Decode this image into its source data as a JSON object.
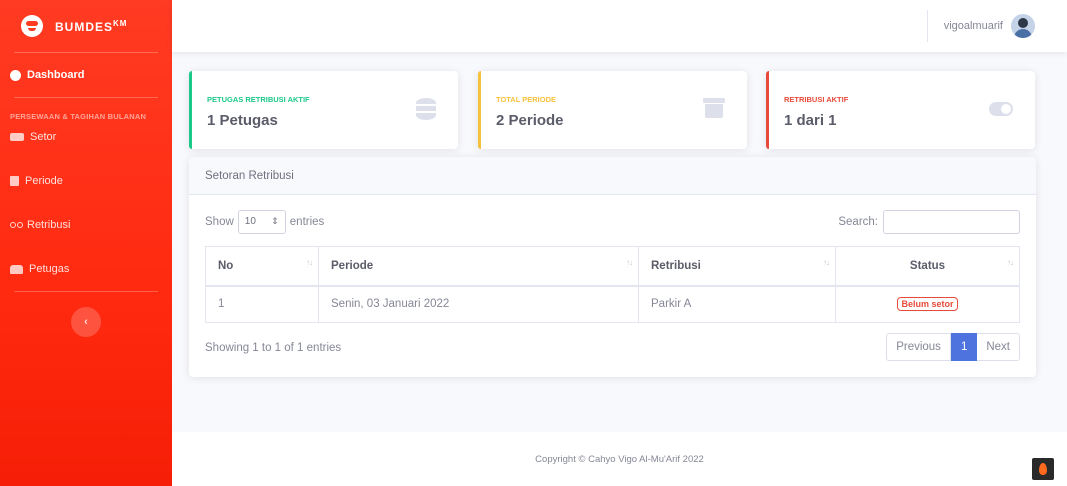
{
  "brand": {
    "name": "BUMDES",
    "superscript": "KM"
  },
  "sidebar": {
    "dashboard": "Dashboard",
    "heading": "PERSEWAAN & TAGIHAN BULANAN",
    "items": [
      {
        "label": "Setor",
        "icon": "money-icon"
      },
      {
        "label": "Periode",
        "icon": "calendar-icon"
      },
      {
        "label": "Retribusi",
        "icon": "bicycle-icon"
      },
      {
        "label": "Petugas",
        "icon": "users-icon"
      }
    ],
    "toggle": "‹"
  },
  "topbar": {
    "username": "vigoalmuarif"
  },
  "cards": [
    {
      "label": "Petugas Retribusi Aktif",
      "value": "1 Petugas",
      "color": "#1cc88a",
      "icon": "database-icon"
    },
    {
      "label": "Total Periode",
      "value": "2 Periode",
      "color": "#f6c23e",
      "icon": "archive-icon"
    },
    {
      "label": "Retribusi Aktif",
      "value": "1 dari 1",
      "color": "#e74a3b",
      "icon": "toggle-icon"
    }
  ],
  "table_card": {
    "title": "Setoran Retribusi",
    "show_prefix": "Show",
    "show_value": "10",
    "show_suffix": "entries",
    "search_label": "Search:",
    "columns": [
      "No",
      "Periode",
      "Retribusi",
      "Status"
    ],
    "rows": [
      {
        "no": "1",
        "periode": "Senin, 03 Januari 2022",
        "retribusi": "Parkir A",
        "status": "Belum setor"
      }
    ],
    "info": "Showing 1 to 1 of 1 entries",
    "pagination": {
      "previous": "Previous",
      "current": "1",
      "next": "Next"
    }
  },
  "footer": {
    "copyright": "Copyright © Cahyo Vigo Al-Mu'Arif 2022"
  }
}
